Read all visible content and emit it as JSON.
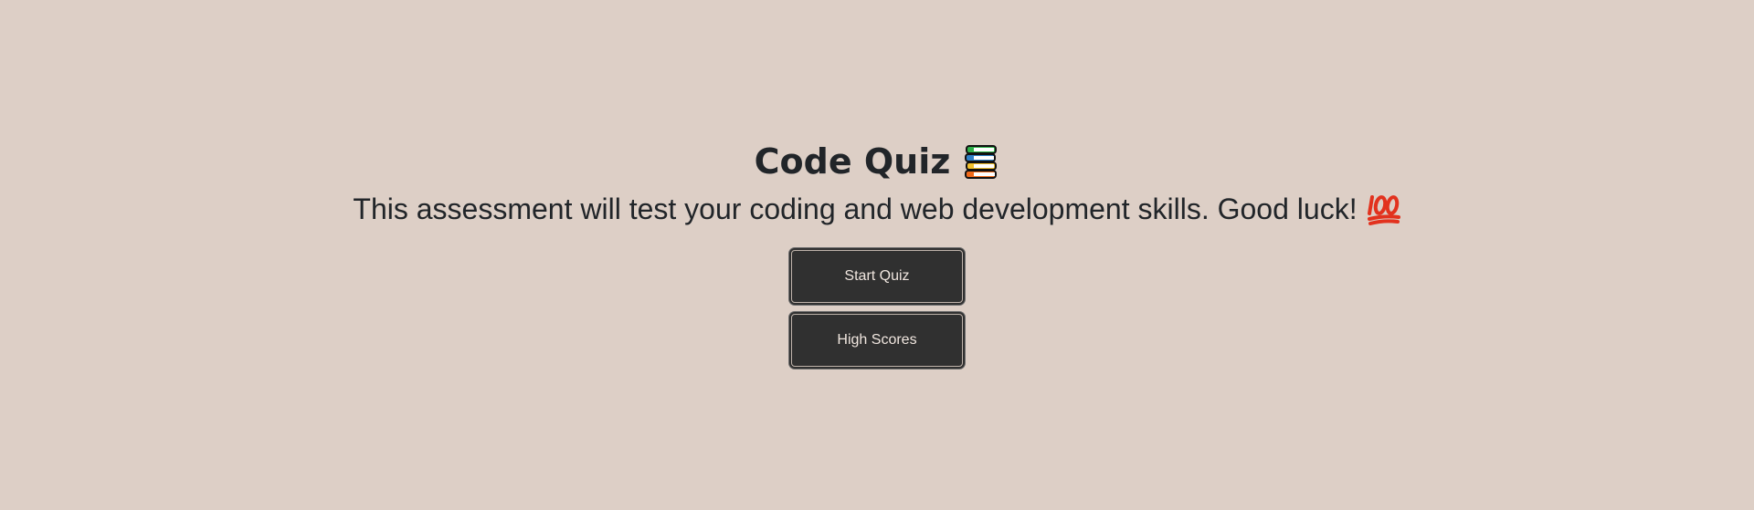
{
  "header": {
    "title": "Code Quiz",
    "title_icon": "books-icon"
  },
  "intro": {
    "description": "This assessment will test your coding and web development skills. Good luck!",
    "description_icon": "hundred-points-icon"
  },
  "actions": {
    "start_label": "Start Quiz",
    "high_scores_label": "High Scores"
  },
  "colors": {
    "background": "#ddcfc6",
    "button_bg": "#303030",
    "button_text": "#f0e6df",
    "text": "#212529"
  }
}
